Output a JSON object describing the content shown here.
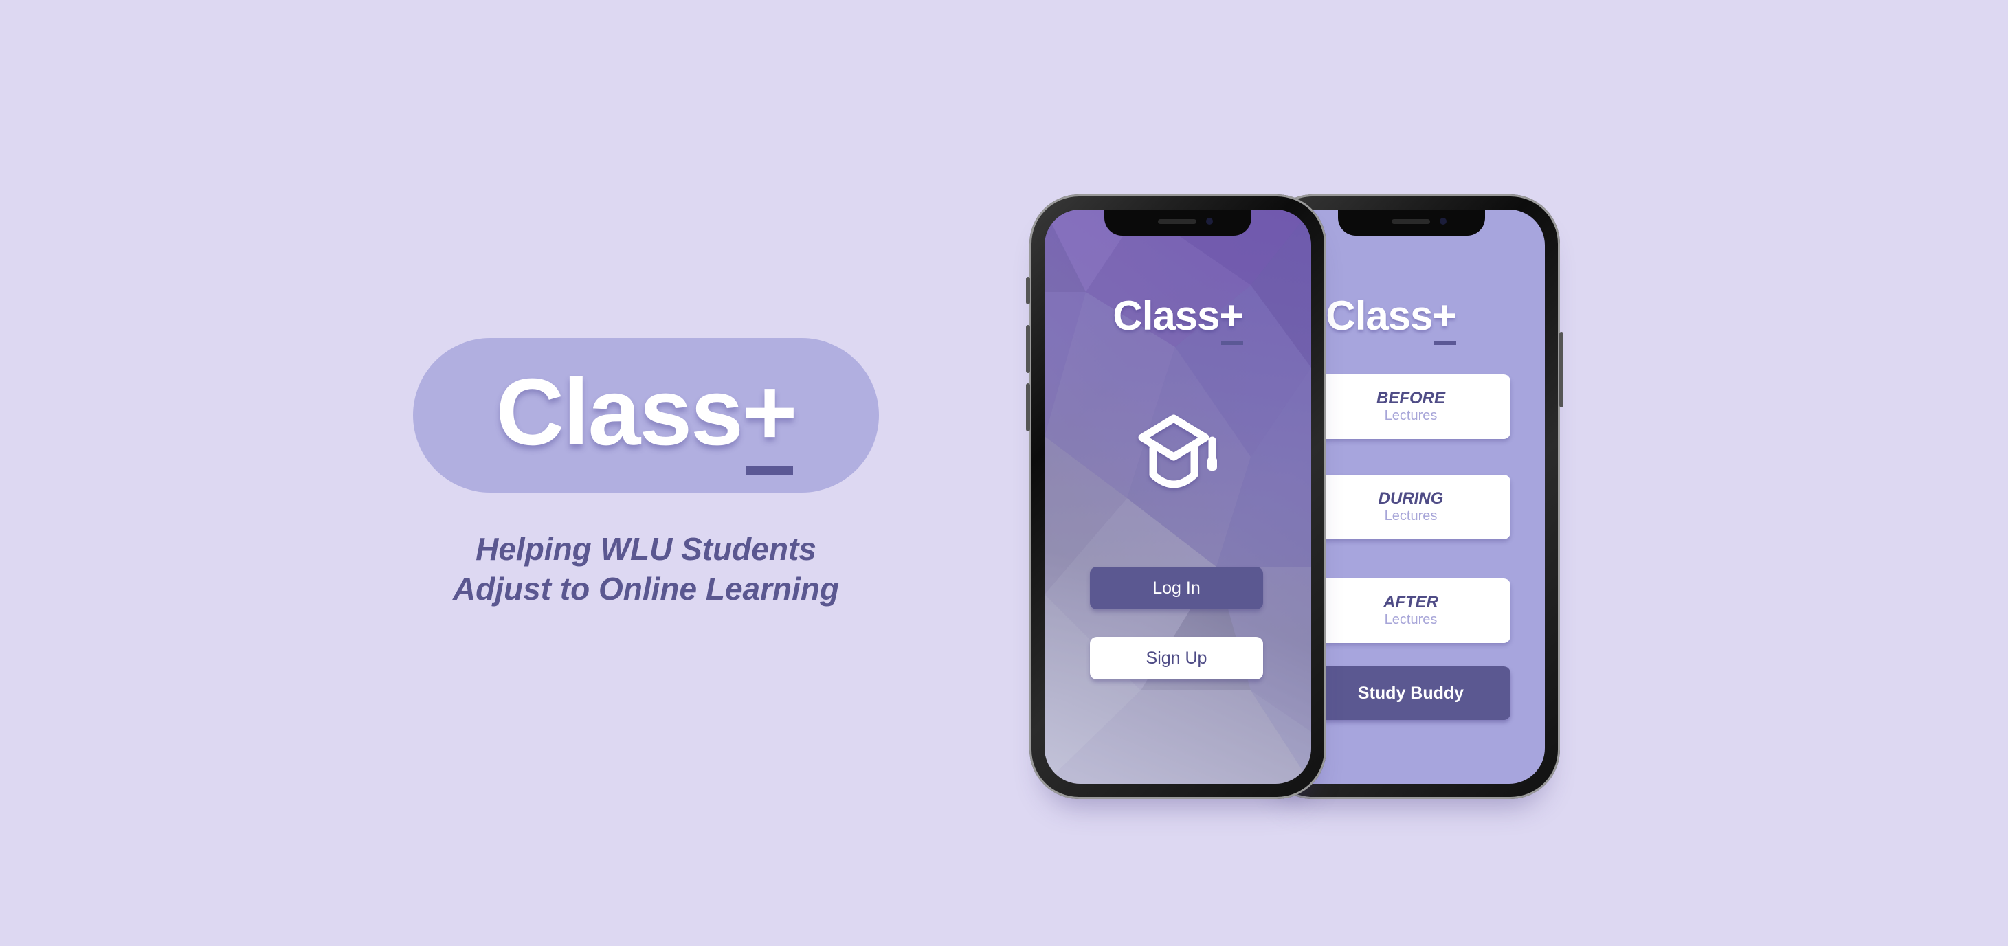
{
  "brand": {
    "name": "Class",
    "plus": "+"
  },
  "tagline": {
    "line1": "Helping WLU Students",
    "line2": "Adjust to Online Learning"
  },
  "login_screen": {
    "logo_name": "Class",
    "logo_plus": "+",
    "icon": "graduation-cap-icon",
    "login_label": "Log In",
    "signup_label": "Sign Up"
  },
  "menu_screen": {
    "logo_name": "Class",
    "logo_plus": "+",
    "cards": [
      {
        "title": "BEFORE",
        "subtitle": "Lectures"
      },
      {
        "title": "DURING",
        "subtitle": "Lectures"
      },
      {
        "title": "AFTER",
        "subtitle": "Lectures"
      }
    ],
    "study_buddy_label": "Study Buddy"
  },
  "colors": {
    "background": "#ddd8f2",
    "pill": "#b1afe0",
    "accent": "#5b5891",
    "card_title": "#4f4c86",
    "card_subtitle": "#a7a5d8"
  }
}
